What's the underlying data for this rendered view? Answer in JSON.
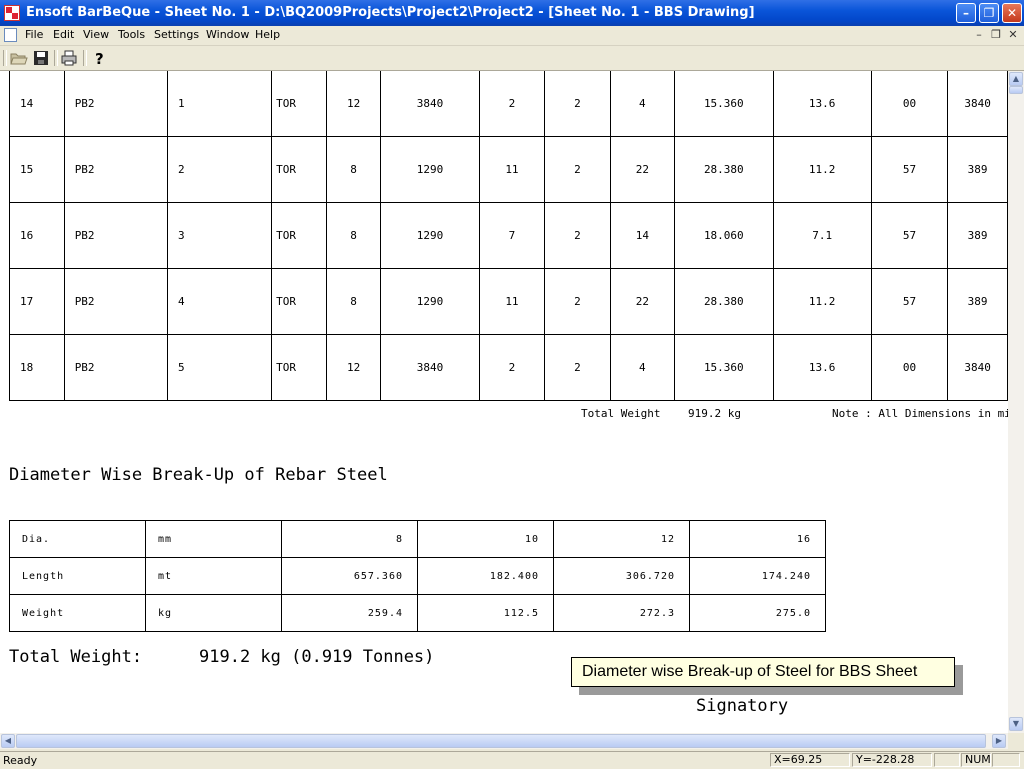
{
  "window": {
    "title": "Ensoft BarBeQue - Sheet No.  1 - D:\\BQ2009Projects\\Project2\\Project2 - [Sheet No. 1 -  BBS Drawing]"
  },
  "menu": [
    "File",
    "Edit",
    "View",
    "Tools",
    "Settings",
    "Window",
    "Help"
  ],
  "toolbar_icons": [
    "open-folder-icon",
    "save-icon",
    "print-icon",
    "help-icon"
  ],
  "bbs_rows": [
    {
      "sr": "14",
      "member": "PB2",
      "mark": "1",
      "type": "TOR",
      "dia": "12",
      "length": "3840",
      "no": "2",
      "set": "2",
      "total": "4",
      "tlength": "15.360",
      "weight": "13.6",
      "a": "00",
      "b": "3840"
    },
    {
      "sr": "15",
      "member": "PB2",
      "mark": "2",
      "type": "TOR",
      "dia": "8",
      "length": "1290",
      "no": "11",
      "set": "2",
      "total": "22",
      "tlength": "28.380",
      "weight": "11.2",
      "a": "57",
      "b": "389"
    },
    {
      "sr": "16",
      "member": "PB2",
      "mark": "3",
      "type": "TOR",
      "dia": "8",
      "length": "1290",
      "no": "7",
      "set": "2",
      "total": "14",
      "tlength": "18.060",
      "weight": "7.1",
      "a": "57",
      "b": "389"
    },
    {
      "sr": "17",
      "member": "PB2",
      "mark": "4",
      "type": "TOR",
      "dia": "8",
      "length": "1290",
      "no": "11",
      "set": "2",
      "total": "22",
      "tlength": "28.380",
      "weight": "11.2",
      "a": "57",
      "b": "389"
    },
    {
      "sr": "18",
      "member": "PB2",
      "mark": "5",
      "type": "TOR",
      "dia": "12",
      "length": "3840",
      "no": "2",
      "set": "2",
      "total": "4",
      "tlength": "15.360",
      "weight": "13.6",
      "a": "00",
      "b": "3840"
    }
  ],
  "totals": {
    "label": "Total Weight",
    "value": "919.2 kg",
    "note": "Note : All Dimensions in mill"
  },
  "breakup": {
    "heading": "Diameter Wise Break-Up of Rebar Steel",
    "rows": [
      {
        "label": "Dia.",
        "unit": "mm",
        "values": [
          "8",
          "10",
          "12",
          "16"
        ]
      },
      {
        "label": "Length",
        "unit": "mt",
        "values": [
          "657.360",
          "182.400",
          "306.720",
          "174.240"
        ]
      },
      {
        "label": "Weight",
        "unit": "kg",
        "values": [
          "259.4",
          "112.5",
          "272.3",
          "275.0"
        ]
      }
    ],
    "total_label": "Total Weight:",
    "total_value": "919.2 kg (0.919 Tonnes)"
  },
  "signatory": "Signatory",
  "tooltip": "Diameter wise Break-up of Steel for BBS Sheet",
  "status": {
    "text": "Ready",
    "x": "X=69.25",
    "y": "Y=-228.28",
    "num": "NUM"
  }
}
